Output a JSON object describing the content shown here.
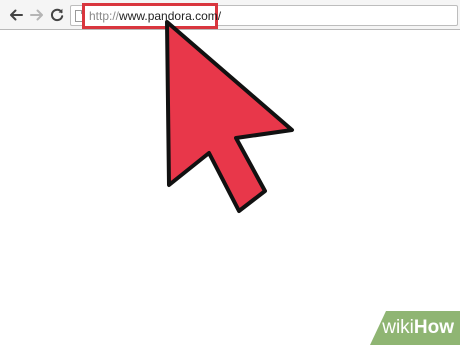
{
  "browser": {
    "url_protocol": "http://",
    "url_host": "www.pandora.com/",
    "back_icon": "back-arrow-icon",
    "forward_icon": "forward-arrow-icon",
    "reload_icon": "reload-icon",
    "page_icon": "page-icon"
  },
  "overlay": {
    "cursor_icon": "mouse-pointer-icon",
    "cursor_color": "#e8374a",
    "highlight_color": "#d9363e"
  },
  "watermark": {
    "wiki": "wiki",
    "how": "How"
  }
}
